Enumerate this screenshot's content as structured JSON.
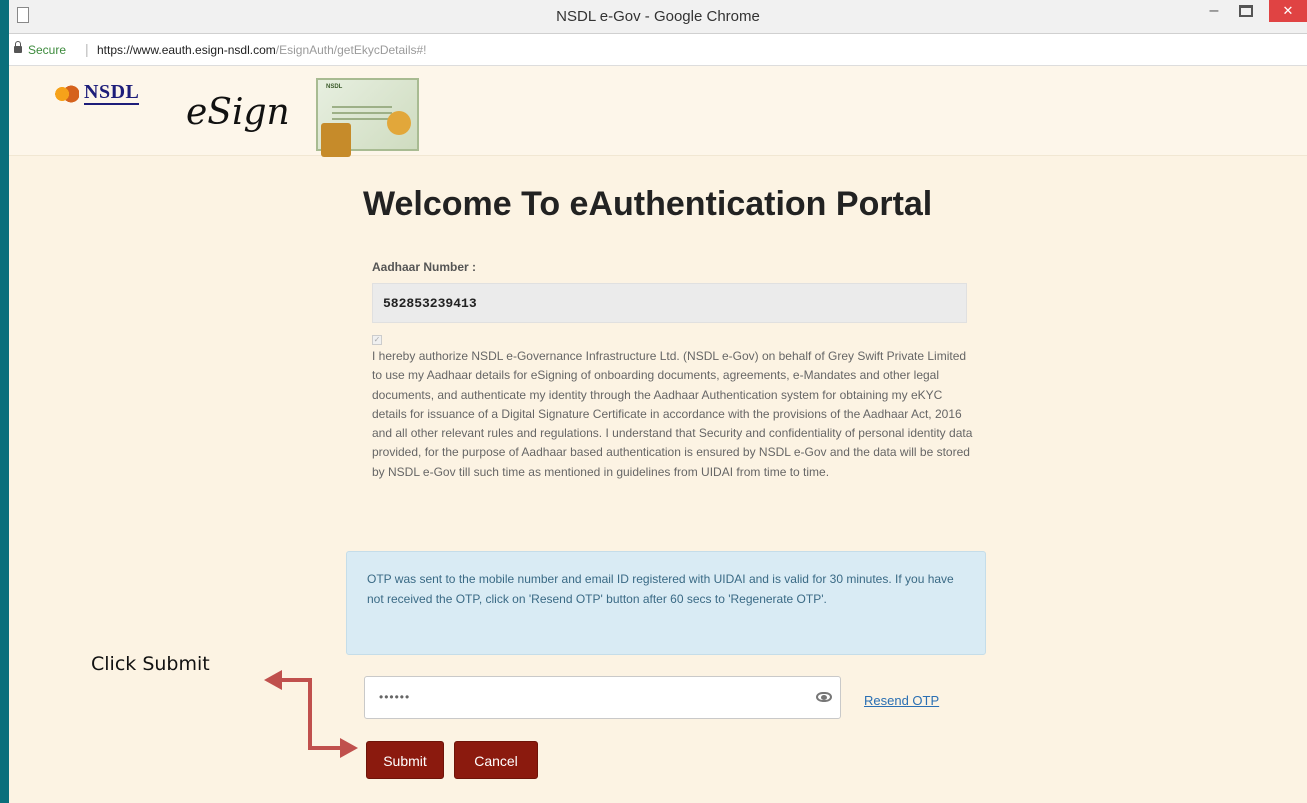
{
  "window": {
    "title": "NSDL e-Gov - Google Chrome",
    "close_label": "✕"
  },
  "address_bar": {
    "secure_label": "Secure",
    "url_host": "https://www.eauth.esign-nsdl.com",
    "url_path": "/EsignAuth/getEkycDetails#!"
  },
  "header": {
    "nsdl_logo_text": "NSDL",
    "esign_logo_text": "eSign",
    "certificate_title": "NSDL Certificate"
  },
  "main": {
    "welcome_title": "Welcome To eAuthentication Portal",
    "aadhaar_label": "Aadhaar Number :",
    "aadhaar_value": "582853239413",
    "consent_checked": true,
    "consent_text": "I hereby authorize NSDL e-Governance Infrastructure Ltd. (NSDL e-Gov) on behalf of Grey Swift Private Limited to use my Aadhaar details for eSigning of onboarding documents, agreements, e-Mandates and other legal documents, and authenticate my identity through the Aadhaar Authentication system for obtaining my eKYC details for issuance of a Digital Signature Certificate in accordance with the provisions of the Aadhaar Act, 2016 and all other relevant rules and regulations. I understand that Security and confidentiality of personal identity data provided, for the purpose of Aadhaar based authentication is ensured by NSDL e-Gov and the data will be stored by NSDL e-Gov till such time as mentioned in guidelines from UIDAI from time to time.",
    "otp_info": "OTP was sent to the mobile number and email ID registered with UIDAI and is valid for 30 minutes. If you have not received the OTP, click on 'Resend OTP' button after 60 secs to 'Regenerate OTP'.",
    "otp_value": "••••••",
    "resend_label": "Resend OTP",
    "submit_label": "Submit",
    "cancel_label": "Cancel"
  },
  "annotation": {
    "label": "Click Submit",
    "color": "#c0504d"
  },
  "colors": {
    "frame": "#0e7b88",
    "page_bg": "#fcf3e3",
    "button": "#8b1a0e",
    "info_bg": "#d9ebf4",
    "link": "#2a6fb3"
  }
}
